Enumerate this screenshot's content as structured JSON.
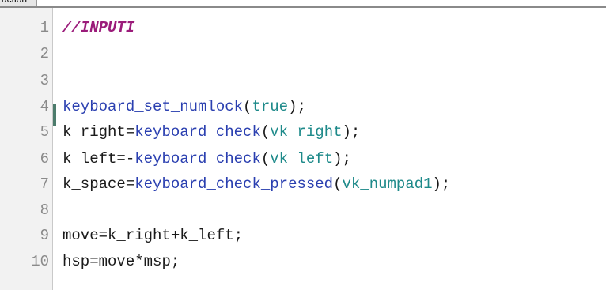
{
  "tab": {
    "label": "action"
  },
  "lines": [
    {
      "num": "1",
      "tokens": [
        {
          "t": "//INPUTI",
          "k": "comment"
        }
      ]
    },
    {
      "num": "2",
      "tokens": []
    },
    {
      "num": "3",
      "tokens": []
    },
    {
      "num": "4",
      "tokens": [
        {
          "t": "keyboard_set_numlock",
          "k": "func"
        },
        {
          "t": "(",
          "k": "punc"
        },
        {
          "t": "true",
          "k": "const"
        },
        {
          "t": ");",
          "k": "punc"
        }
      ]
    },
    {
      "num": "5",
      "tokens": [
        {
          "t": "k_right",
          "k": "var"
        },
        {
          "t": "=",
          "k": "punc"
        },
        {
          "t": "keyboard_check",
          "k": "func"
        },
        {
          "t": "(",
          "k": "punc"
        },
        {
          "t": "vk_right",
          "k": "const"
        },
        {
          "t": ");",
          "k": "punc"
        }
      ]
    },
    {
      "num": "6",
      "tokens": [
        {
          "t": "k_left",
          "k": "var"
        },
        {
          "t": "=-",
          "k": "punc"
        },
        {
          "t": "keyboard_check",
          "k": "func"
        },
        {
          "t": "(",
          "k": "punc"
        },
        {
          "t": "vk_left",
          "k": "const"
        },
        {
          "t": ");",
          "k": "punc"
        }
      ]
    },
    {
      "num": "7",
      "tokens": [
        {
          "t": "k_space",
          "k": "var"
        },
        {
          "t": "=",
          "k": "punc"
        },
        {
          "t": "keyboard_check_pressed",
          "k": "func"
        },
        {
          "t": "(",
          "k": "punc"
        },
        {
          "t": "vk_numpad1",
          "k": "const"
        },
        {
          "t": ");",
          "k": "punc"
        }
      ]
    },
    {
      "num": "8",
      "tokens": []
    },
    {
      "num": "9",
      "tokens": [
        {
          "t": "move",
          "k": "var"
        },
        {
          "t": "=",
          "k": "punc"
        },
        {
          "t": "k_right",
          "k": "var"
        },
        {
          "t": "+",
          "k": "punc"
        },
        {
          "t": "k_left",
          "k": "var"
        },
        {
          "t": ";",
          "k": "punc"
        }
      ]
    },
    {
      "num": "10",
      "tokens": [
        {
          "t": "hsp",
          "k": "var"
        },
        {
          "t": "=",
          "k": "punc"
        },
        {
          "t": "move",
          "k": "var"
        },
        {
          "t": "*",
          "k": "punc"
        },
        {
          "t": "msp",
          "k": "var"
        },
        {
          "t": ";",
          "k": "punc"
        }
      ]
    }
  ],
  "colors": {
    "comment": "#9b1b7a",
    "function": "#2a3fb0",
    "constant": "#1e8a8a",
    "variable": "#1a1a1a",
    "line_number": "#8a8a8a",
    "gutter": "#f2f2f2",
    "change_marker": "#4c7c6c"
  },
  "current_line": "4"
}
